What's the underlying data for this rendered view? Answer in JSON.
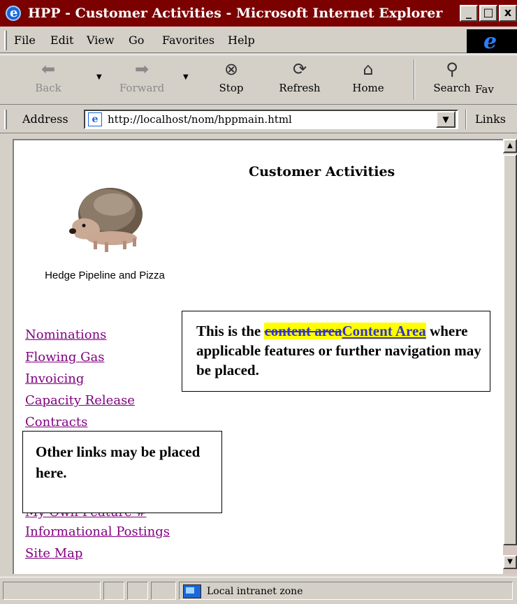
{
  "window": {
    "title": "HPP - Customer Activities - Microsoft Internet Explorer",
    "controls": {
      "minimize": "_",
      "maximize": "□",
      "close": "x"
    }
  },
  "menu": [
    "File",
    "Edit",
    "View",
    "Go",
    "Favorites",
    "Help"
  ],
  "toolbar": {
    "back": {
      "label": "Back",
      "icon": "arrow-left-icon",
      "disabled": true
    },
    "forward": {
      "label": "Forward",
      "icon": "arrow-right-icon",
      "disabled": true
    },
    "stop": {
      "label": "Stop",
      "icon": "stop-icon"
    },
    "refresh": {
      "label": "Refresh",
      "icon": "refresh-icon"
    },
    "home": {
      "label": "Home",
      "icon": "home-icon"
    },
    "search": {
      "label": "Search",
      "icon": "search-icon"
    },
    "favorites": {
      "label": "Fav",
      "icon": "favorites-icon"
    }
  },
  "address": {
    "label": "Address",
    "url": "http://localhost/nom/hppmain.html",
    "links_label": "Links"
  },
  "page": {
    "title": "Customer Activities",
    "company": "Hedge Pipeline and Pizza",
    "nav": [
      "Nominations",
      "Flowing Gas",
      "Invoicing",
      "Capacity Release",
      "Contracts",
      "Informational Postings",
      "Site Map"
    ],
    "hidden_nav_fragment": "My Own Feature #",
    "content_box": {
      "prefix": "This is the ",
      "deleted": "content area",
      "inserted": "Content Area",
      "suffix": " where  applicable features or further navigation may be placed."
    },
    "other_box": "Other links may be placed here."
  },
  "status": {
    "zone": "Local intranet zone"
  },
  "colors": {
    "titlebar": "#7b0000",
    "chrome": "#d4d0c8",
    "visited_link": "#800080",
    "highlight": "#ffff00",
    "revision_link": "#3333cc"
  }
}
